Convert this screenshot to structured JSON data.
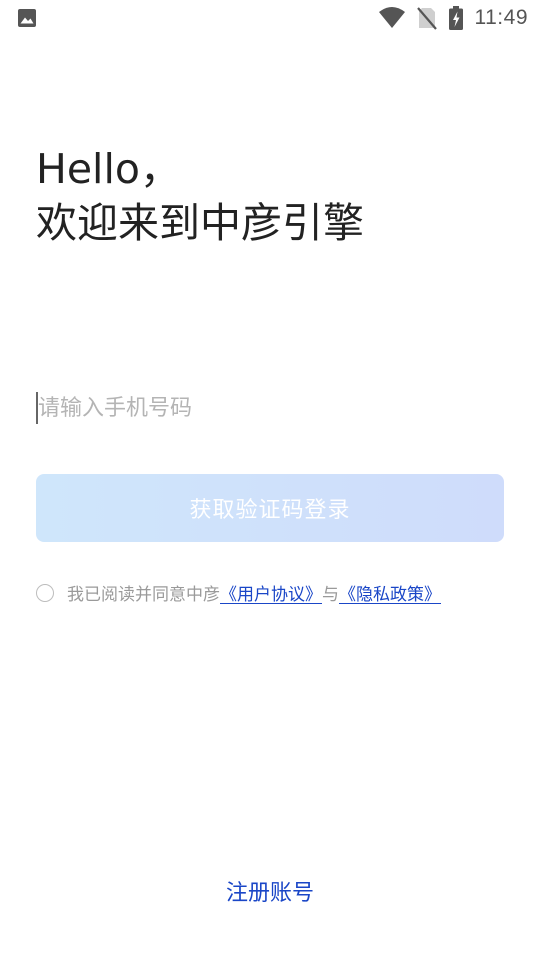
{
  "status_bar": {
    "time": "11:49",
    "left_icon": "image-notification-icon",
    "right_icons": [
      "wifi-icon",
      "no-sim-icon",
      "battery-charging-icon"
    ]
  },
  "greeting": {
    "line1": "Hello，",
    "line2": "欢迎来到中彦引擎"
  },
  "phone": {
    "placeholder": "请输入手机号码",
    "value": ""
  },
  "login_button": {
    "label": "获取验证码登录"
  },
  "agreement": {
    "checked": false,
    "prefix": "我已阅读并同意中彦",
    "user_agreement": "《用户协议》",
    "connector": "与",
    "privacy_policy": "《隐私政策》"
  },
  "register": {
    "label": "注册账号"
  },
  "colors": {
    "link": "#1a46c7",
    "button_gradient_start": "#cfe6fb",
    "button_gradient_end": "#cfdcfb",
    "placeholder": "#b4b4b4"
  }
}
